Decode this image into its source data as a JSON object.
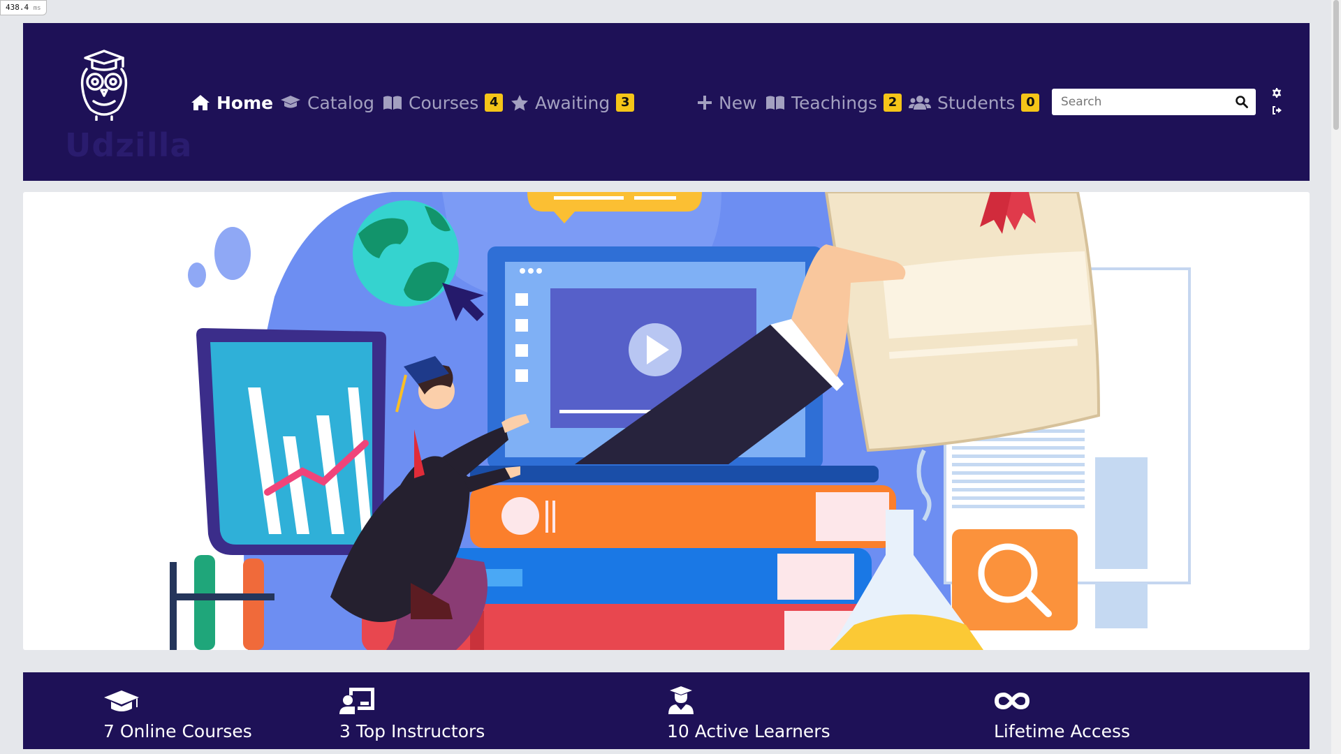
{
  "perf": {
    "value": "438.4",
    "unit": "ms"
  },
  "brand": {
    "name": "Udzilla"
  },
  "nav": {
    "home": "Home",
    "catalog": "Catalog",
    "courses": {
      "label": "Courses",
      "count": "4"
    },
    "awaiting": {
      "label": "Awaiting",
      "count": "3"
    },
    "new": "New",
    "teachings": {
      "label": "Teachings",
      "count": "2"
    },
    "students": {
      "label": "Students",
      "count": "0"
    }
  },
  "search": {
    "placeholder": "Search",
    "value": ""
  },
  "stats": [
    {
      "label": "7 Online Courses",
      "icon": "graduation-cap-icon"
    },
    {
      "label": "3 Top Instructors",
      "icon": "chalkboard-teacher-icon"
    },
    {
      "label": "10 Active Learners",
      "icon": "user-graduate-icon"
    },
    {
      "label": "Lifetime Access",
      "icon": "infinity-icon"
    }
  ],
  "colors": {
    "navbar": "#1e1157",
    "badge": "#f5c518",
    "page_bg": "#e5e7eb"
  }
}
